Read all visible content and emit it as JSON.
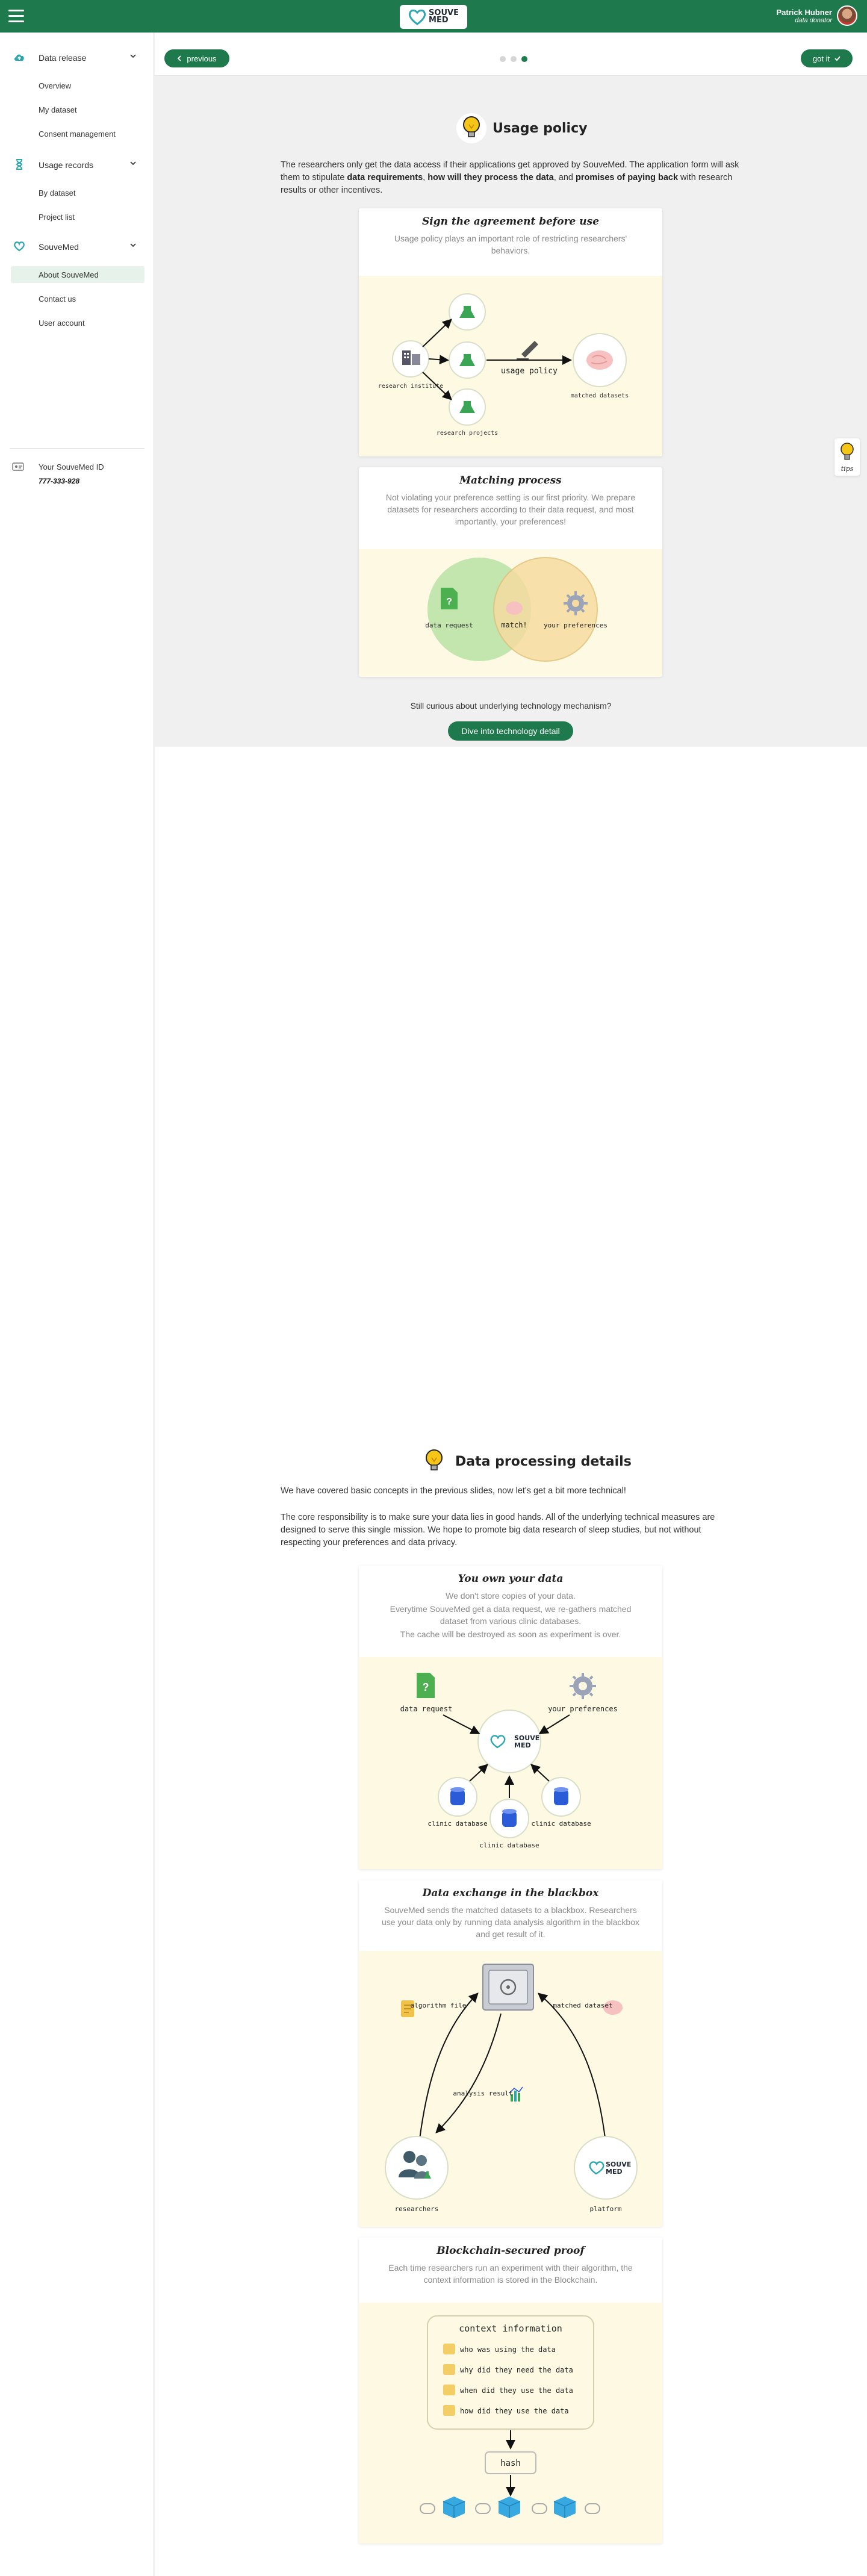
{
  "header": {
    "brand_line1": "SOUVE",
    "brand_line2": "MED",
    "user_name": "Patrick Hubner",
    "user_role": "data donator"
  },
  "sidebar": {
    "groups": [
      {
        "label": "Data release",
        "icon": "cloud-upload-icon",
        "items": [
          "Overview",
          "My dataset",
          "Consent management"
        ]
      },
      {
        "label": "Usage records",
        "icon": "hourglass-icon",
        "items": [
          "By dataset",
          "Project list"
        ]
      },
      {
        "label": "SouveMed",
        "icon": "heart-icon",
        "items": [
          "About SouveMed",
          "Contact us",
          "User account"
        ]
      }
    ],
    "active_item": "About SouveMed",
    "id_label": "Your SouveMed ID",
    "id_value": "777-333-928"
  },
  "pager": {
    "previous_label": "previous",
    "got_it_label": "got it",
    "total_pages": 3,
    "current_page": 3
  },
  "tips_label": "tips",
  "usage_policy": {
    "title": "Usage policy",
    "intro_1": "The researchers only get the data access if their applications get approved by SouveMed. The application form will ask them to stipulate ",
    "intro_b1": "data requirements",
    "intro_2": ", ",
    "intro_b2": "how will they process the data",
    "intro_3": ", and ",
    "intro_b3": "promises of paying back",
    "intro_4": " with research results or other incentives.",
    "card1": {
      "title": "Sign the agreement before use",
      "desc": "Usage policy plays an important role of restricting researchers' behaviors.",
      "label_institute": "research institute",
      "label_projects": "research projects",
      "label_policy": "usage policy",
      "label_matched": "matched datasets"
    },
    "card2": {
      "title": "Matching process",
      "desc": "Not violating your preference setting is our first priority. We prepare datasets for researchers according to their data request, and most importantly, your preferences!",
      "label_request": "data request",
      "label_match": "match!",
      "label_prefs": "your preferences"
    },
    "curious_text": "Still curious about underlying technology mechanism?",
    "dive_label": "Dive into technology detail"
  },
  "data_processing": {
    "title": "Data processing details",
    "para1": "We have covered basic concepts in the previous slides, now let's get a bit more technical!",
    "para2": "The core responsibility is to make sure your data lies in good hands. All of the underlying technical measures are designed to serve this single mission. We hope to promote big data research of sleep studies, but not without respecting your preferences and data privacy.",
    "card1": {
      "title": "You own your data",
      "desc1": "We don't store copies of your data.",
      "desc2": "Everytime SouveMed get a data request, we re-gathers matched dataset from various clinic databases.",
      "desc3": "The cache will be destroyed as soon as experiment is over.",
      "label_request": "data request",
      "label_prefs": "your preferences",
      "label_db": "clinic database"
    },
    "card2": {
      "title": "Data exchange in the blackbox",
      "desc": "SouveMed sends the matched datasets to a blackbox. Researchers use your data only by running data analysis algorithm in the blackbox and get result of it.",
      "label_algorithm": "algorithm file",
      "label_matched": "matched dataset",
      "label_result": "analysis result",
      "label_researchers": "researchers",
      "label_platform": "platform"
    },
    "card3": {
      "title": "Blockchain-secured proof",
      "desc": "Each time researchers run an experiment with their algorithm, the context information is stored in the Blockchain.",
      "box_title": "context information",
      "questions": [
        "who was using the data",
        "why did they need the data",
        "when did they use the data",
        "how did they use the data"
      ],
      "hash_label": "hash"
    }
  },
  "colors": {
    "brand_green": "#1e7a4c",
    "active_bg": "#e6f2ea",
    "diagram_bg": "#fdf9e3",
    "venn_green": "#b9e3a6",
    "venn_yellow": "#f6dca0",
    "cube_blue": "#38a8e0"
  }
}
